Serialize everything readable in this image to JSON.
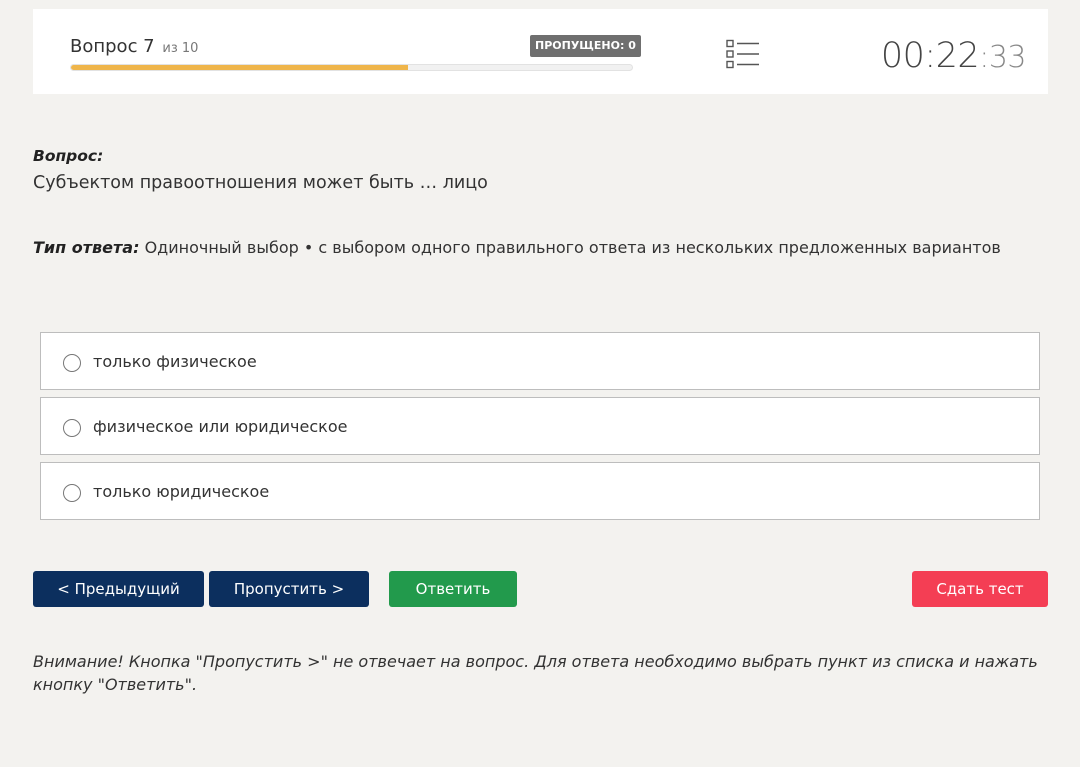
{
  "header": {
    "question_word": "Вопрос 7",
    "question_of": "из 10",
    "skipped_label": "ПРОПУЩЕНО: 0",
    "progress_fraction": 0.6,
    "timer_main": "00:22",
    "timer_colon": ":",
    "timer_seconds": "33"
  },
  "question": {
    "label": "Вопрос:",
    "text": "Субъектом правоотношения может быть … лицо"
  },
  "answer_type": {
    "label": "Тип ответа:",
    "text": "Одиночный выбор • с выбором одного правильного ответа из нескольких предложенных вариантов"
  },
  "options": [
    {
      "label": "только физическое"
    },
    {
      "label": "физическое или юридическое"
    },
    {
      "label": "только юридическое"
    }
  ],
  "buttons": {
    "prev": "< Предыдущий",
    "skip": "Пропустить >",
    "answer": "Ответить",
    "submit": "Сдать тест"
  },
  "warning": "Внимание! Кнопка \"Пропустить >\" не отвечает на вопрос. Для ответа необходимо выбрать пункт из списка и нажать кнопку \"Ответить\".",
  "icons": {
    "question_list": "list-icon"
  },
  "colors": {
    "progress": "#efb54a",
    "nav_button": "#0c2f5e",
    "answer_button": "#229a4c",
    "submit_button": "#f43e54"
  }
}
